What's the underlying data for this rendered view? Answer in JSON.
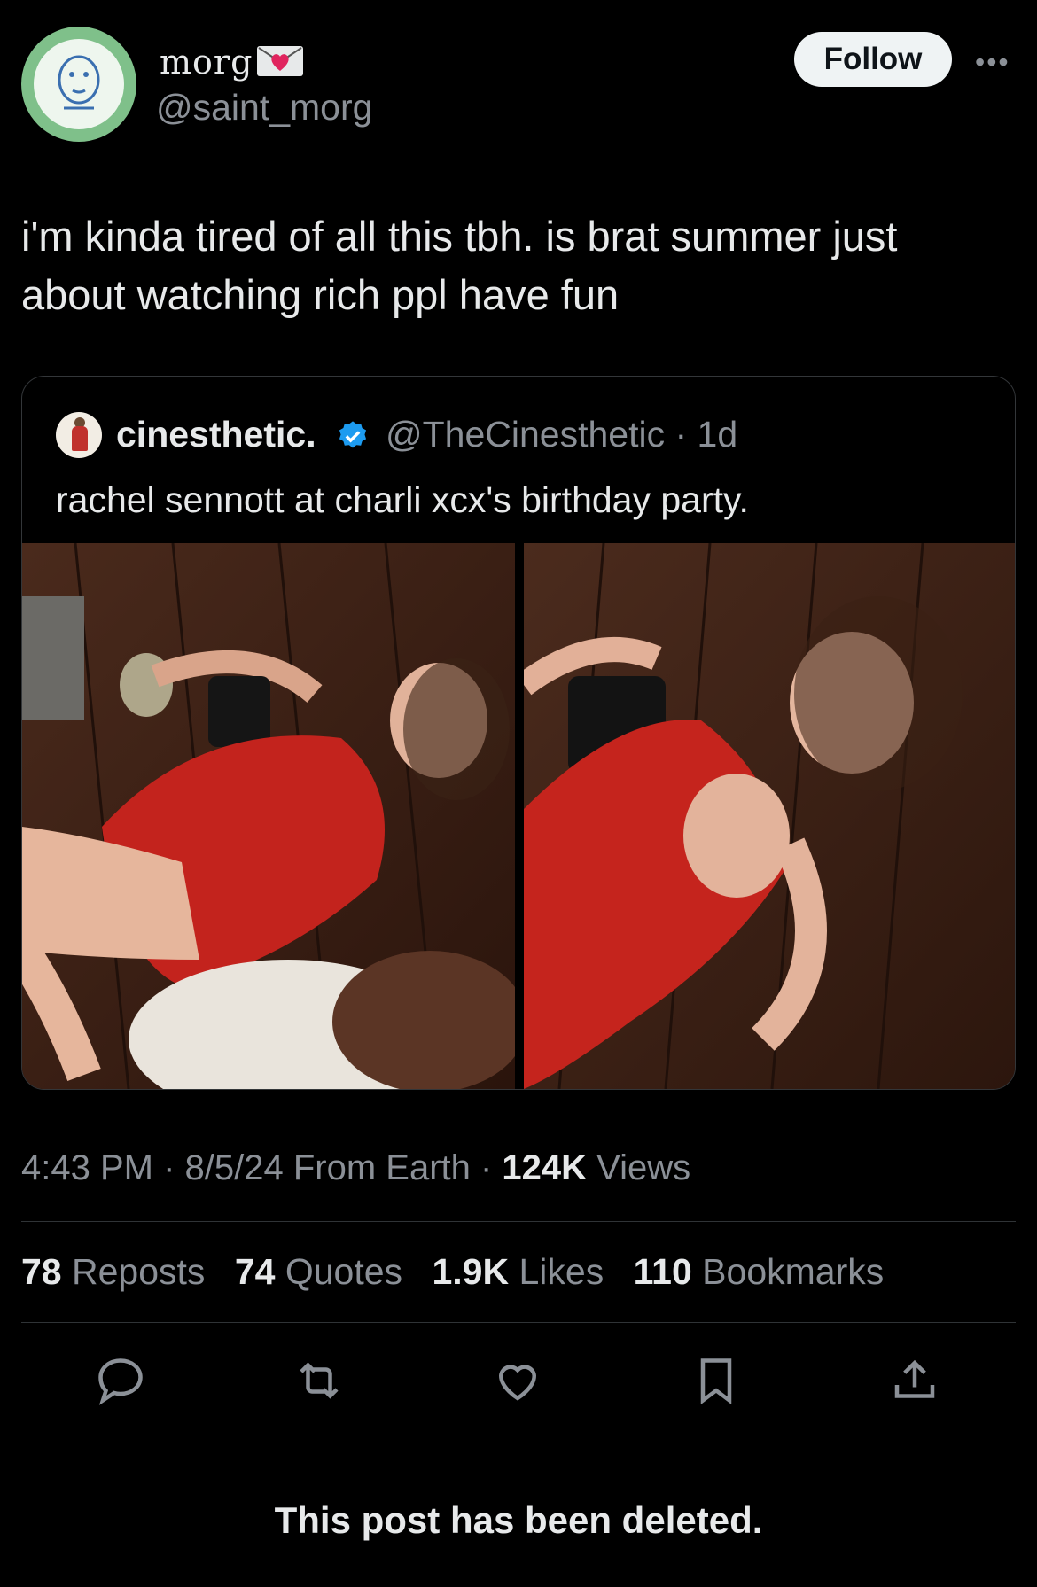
{
  "author": {
    "display_name": "morg",
    "handle": "@saint_morg",
    "follow_label": "Follow"
  },
  "tweet": {
    "text": "i'm kinda tired of all this tbh. is brat summer just about watching rich ppl have fun"
  },
  "quote": {
    "display_name": "cinesthetic.",
    "handle_time": "@TheCinesthetic · 1d",
    "text": "rachel sennott at charli xcx's birthday party."
  },
  "meta": {
    "time_date": "4:43 PM · 8/5/24 From Earth · ",
    "views_count": "124K",
    "views_label": " Views"
  },
  "stats": {
    "reposts_count": "78",
    "reposts_label": "Reposts",
    "quotes_count": "74",
    "quotes_label": "Quotes",
    "likes_count": "1.9K",
    "likes_label": "Likes",
    "bookmarks_count": "110",
    "bookmarks_label": "Bookmarks"
  },
  "footer": {
    "deleted_text": "This post has been deleted."
  },
  "icons": [
    "more-icon",
    "verified-icon",
    "reply-icon",
    "repost-icon",
    "like-icon",
    "bookmark-icon",
    "share-icon"
  ],
  "colors": {
    "background": "#000000",
    "text": "#e7e9ea",
    "muted": "#8b9097",
    "verified": "#1d9bf0",
    "badge_heart": "#e0245e"
  }
}
